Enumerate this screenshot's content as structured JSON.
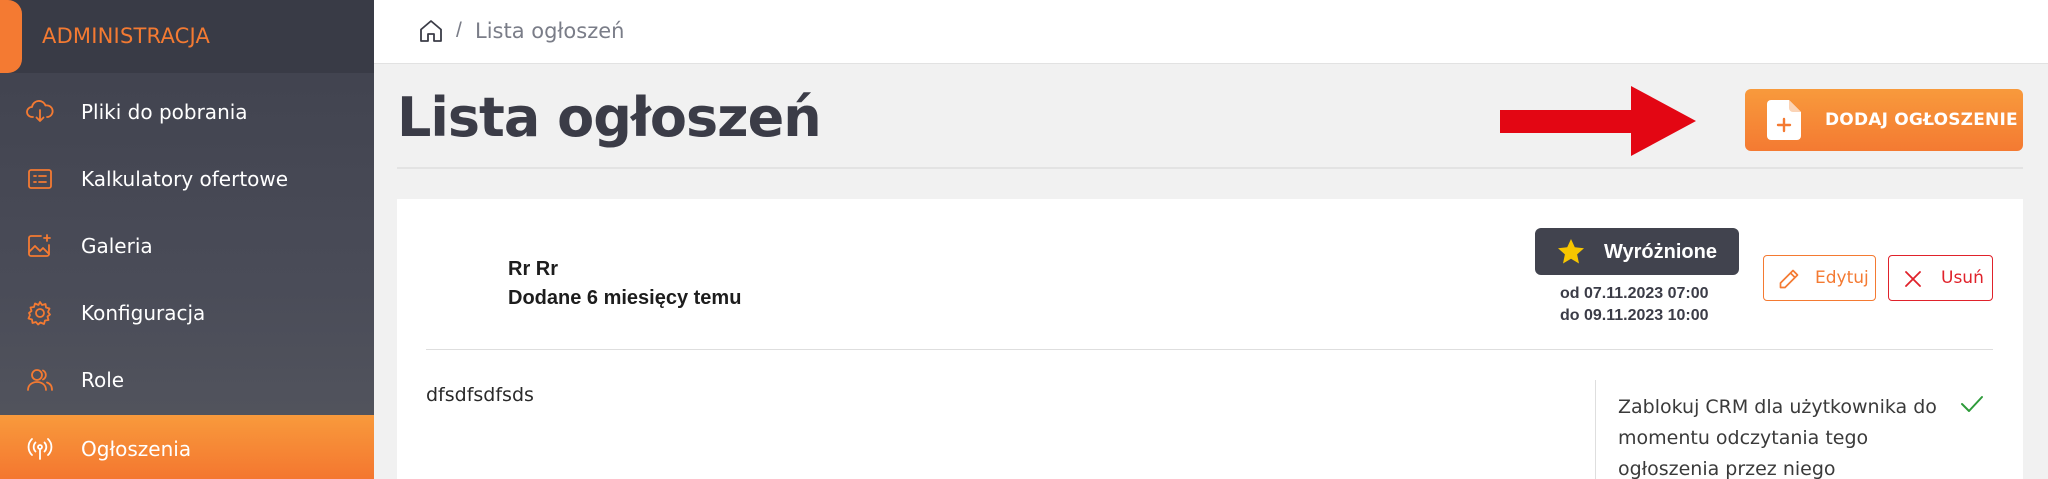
{
  "sidebar": {
    "title": "ADMINISTRACJA",
    "items": [
      {
        "label": "Pliki do pobrania",
        "icon": "cloud-download-icon"
      },
      {
        "label": "Kalkulatory ofertowe",
        "icon": "calculator-list-icon"
      },
      {
        "label": "Galeria",
        "icon": "gallery-image-icon"
      },
      {
        "label": "Konfiguracja",
        "icon": "gear-icon"
      },
      {
        "label": "Role",
        "icon": "users-icon"
      },
      {
        "label": "Ogłoszenia",
        "icon": "broadcast-icon",
        "active": true
      }
    ]
  },
  "breadcrumb": {
    "home_icon": "home-icon",
    "separator": "/",
    "current": "Lista ogłoszeń"
  },
  "page": {
    "title": "Lista ogłoszeń",
    "add_button_label": "DODAJ OGŁOSZENIE"
  },
  "announcement": {
    "author": "Rr Rr",
    "added": "Dodane 6 miesięcy temu",
    "featured_label": "Wyróżnione",
    "date_from": "od 07.11.2023 07:00",
    "date_to": "do 09.11.2023 10:00",
    "edit_label": "Edytuj",
    "delete_label": "Usuń",
    "body": "dfsdfsdfsds",
    "crm_lock_text": "Zablokuj CRM dla użytkownika do momentu odczytania tego ogłoszenia przez niego",
    "crm_lock_checked": true
  },
  "colors": {
    "accent": "#f47a32",
    "danger": "#e0222b",
    "sidebar_bg": "#41434e",
    "annotation_arrow": "#e30613",
    "check": "#2e9b3a",
    "star": "#f7c600"
  }
}
